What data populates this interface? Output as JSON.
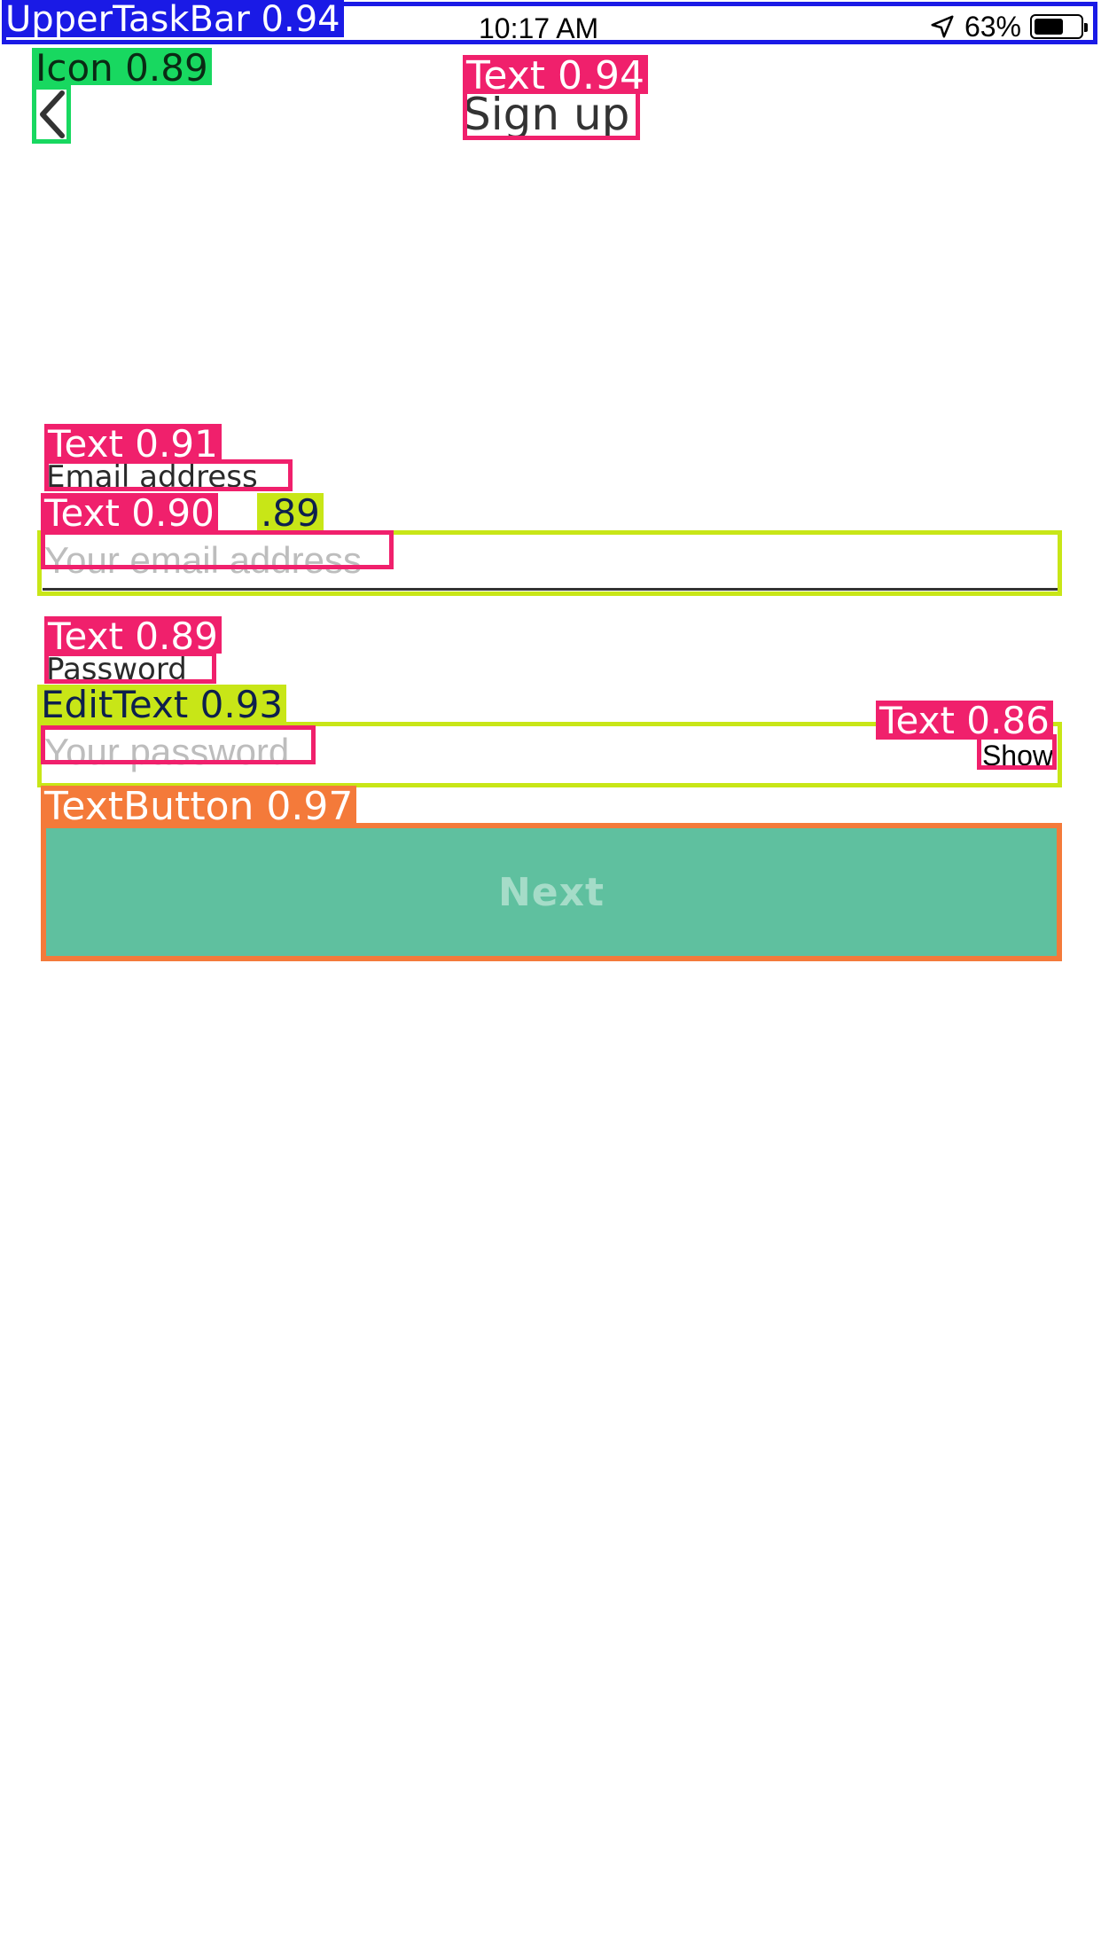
{
  "status_bar": {
    "time": "10:17 AM",
    "battery_percent": "63%",
    "battery_level": 0.63,
    "icons": [
      "location-arrow-icon",
      "battery-icon"
    ]
  },
  "header": {
    "back_icon": "chevron-left-icon",
    "title": "Sign up"
  },
  "form": {
    "email": {
      "label": "Email address",
      "placeholder": "Your email address",
      "value": ""
    },
    "password": {
      "label": "Password",
      "placeholder": "Your password",
      "value": "",
      "toggle_label": "Show"
    },
    "submit_label": "Next"
  },
  "annotations": [
    {
      "label": "UpperTaskBar 0.94",
      "color": "#1a1ae6"
    },
    {
      "label": "Icon 0.89",
      "color": "#18d860"
    },
    {
      "label": "Text 0.94",
      "color": "#f0206c"
    },
    {
      "label": "Text 0.91",
      "color": "#f0206c"
    },
    {
      "label": "Text 0.90",
      "color": "#f0206c"
    },
    {
      "label": ".89",
      "color": "#c8e617"
    },
    {
      "label": "Text 0.89",
      "color": "#f0206c"
    },
    {
      "label": "EditText 0.93",
      "color": "#c8e617"
    },
    {
      "label": "Text 0.86",
      "color": "#f0206c"
    },
    {
      "label": "TextButton 0.97",
      "color": "#f47a3a"
    }
  ]
}
